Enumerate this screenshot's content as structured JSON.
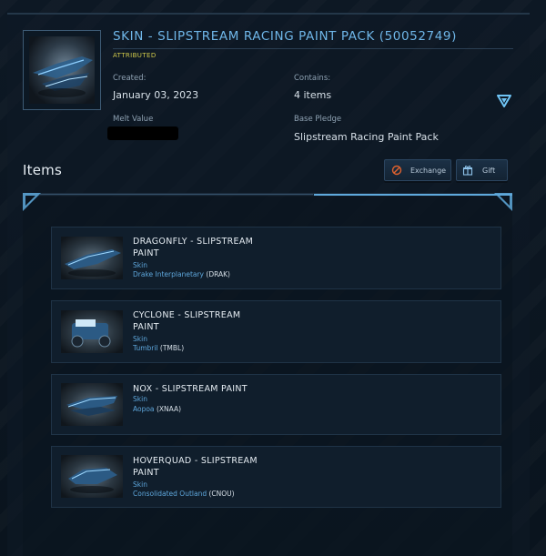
{
  "pledge": {
    "title": "SKIN - SLIPSTREAM RACING PAINT PACK (50052749)",
    "status_badge": "ATTRIBUTED",
    "created_label": "Created:",
    "created_value": "January 03, 2023",
    "contains_label": "Contains:",
    "contains_value": "4 items",
    "melt_label": "Melt Value",
    "base_pledge_label": "Base Pledge",
    "base_pledge_value": "Slipstream Racing Paint Pack"
  },
  "items_section": {
    "title": "Items",
    "exchange_label": "Exchange",
    "gift_label": "Gift"
  },
  "items": [
    {
      "name_line1": "DRAGONFLY - SLIPSTREAM",
      "name_line2": "PAINT",
      "type": "Skin",
      "manufacturer": "Drake Interplanetary",
      "code": "(DRAK)"
    },
    {
      "name_line1": "CYCLONE - SLIPSTREAM",
      "name_line2": "PAINT",
      "type": "Skin",
      "manufacturer": "Tumbril",
      "code": "(TMBL)"
    },
    {
      "name_line1": "NOX - SLIPSTREAM PAINT",
      "name_line2": "",
      "type": "Skin",
      "manufacturer": "Aopoa",
      "code": "(XNAA)"
    },
    {
      "name_line1": "HOVERQUAD - SLIPSTREAM",
      "name_line2": "PAINT",
      "type": "Skin",
      "manufacturer": "Consolidated Outland",
      "code": "(CNOU)"
    }
  ],
  "colors": {
    "accent": "#6fb6e8",
    "badge": "#d0c94a",
    "link": "#5ea7dc",
    "background": "#0b1520"
  },
  "icons": {
    "exchange": "exchange-icon",
    "gift": "gift-icon",
    "expand": "chevron-down-icon"
  }
}
